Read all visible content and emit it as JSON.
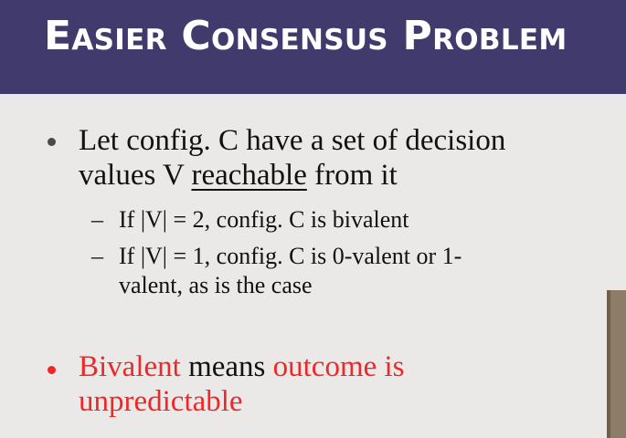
{
  "slide": {
    "title": "Easier Consensus Problem",
    "bullets": [
      {
        "line1": "Let config. C have a set of decision",
        "line2_before": "values V ",
        "line2_underlined": "reachable",
        "line2_after": " from it",
        "subbullets": [
          {
            "text": "If |V| = 2, config. C is bivalent"
          },
          {
            "line1": "If |V| = 1, config. C is 0-valent or 1-",
            "line2": "valent, as is the case"
          }
        ]
      },
      {
        "line1_red": "Bivalent",
        "line1_black": " means ",
        "line1_red2": "outcome is",
        "line2_red": "unpredictable"
      }
    ]
  },
  "colors": {
    "title_bar": "#413b6d",
    "background": "#ebe9e8",
    "accent_red": "#ee2828",
    "bullet_dark": "#4a4a4a"
  }
}
